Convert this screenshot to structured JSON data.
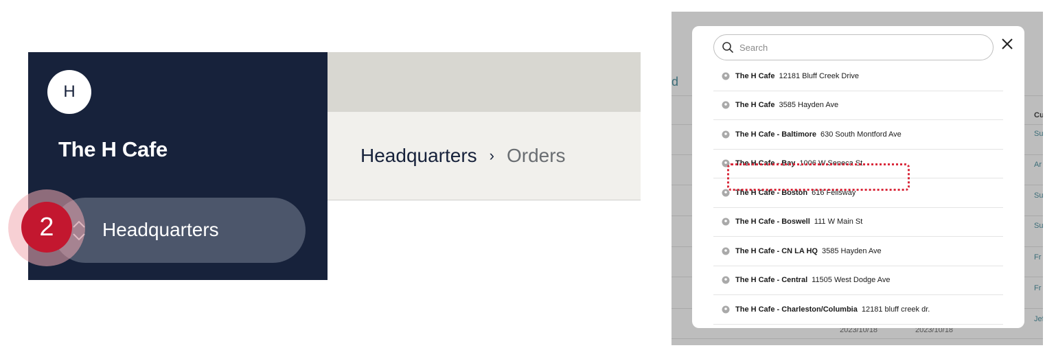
{
  "sidebar": {
    "avatar_initial": "H",
    "org_name": "The H Cafe",
    "location_label": "Headquarters"
  },
  "step_badge": "2",
  "breadcrumb": {
    "items": [
      "Headquarters",
      "Orders"
    ],
    "separator": "›"
  },
  "background": {
    "link_fragment": "d",
    "column_header_fragment": "Cu",
    "cell_fragments": [
      "Su",
      "Ar",
      "Su",
      "Su",
      "Fr",
      "Fr",
      "Jef"
    ],
    "dates": [
      "2023/10/18",
      "2023/10/18"
    ]
  },
  "location_picker": {
    "search_placeholder": "Search",
    "close_icon": "close-icon",
    "highlighted_index": 3,
    "items": [
      {
        "name": "The H Cafe",
        "address": "12181 Bluff Creek Drive"
      },
      {
        "name": "The H Cafe",
        "address": "3585 Hayden Ave"
      },
      {
        "name": "The H Cafe - Baltimore",
        "address": "630 South Montford Ave"
      },
      {
        "name": "The H Cafe - Bay",
        "address": "1006 W Seneca St"
      },
      {
        "name": "The H Cafe - Boston",
        "address": "616 Fellsway"
      },
      {
        "name": "The H Cafe - Boswell",
        "address": "111 W Main St"
      },
      {
        "name": "The H Cafe - CN LA HQ",
        "address": "3585 Hayden Ave"
      },
      {
        "name": "The H Cafe - Central",
        "address": "11505 West Dodge Ave"
      },
      {
        "name": "The H Cafe - Charleston/Columbia",
        "address": "12181 bluff creek dr."
      }
    ]
  },
  "colors": {
    "navy": "#17223b",
    "badge_red": "#c3172f",
    "highlight_red": "#d9283a",
    "link_teal": "#3b6d78"
  }
}
